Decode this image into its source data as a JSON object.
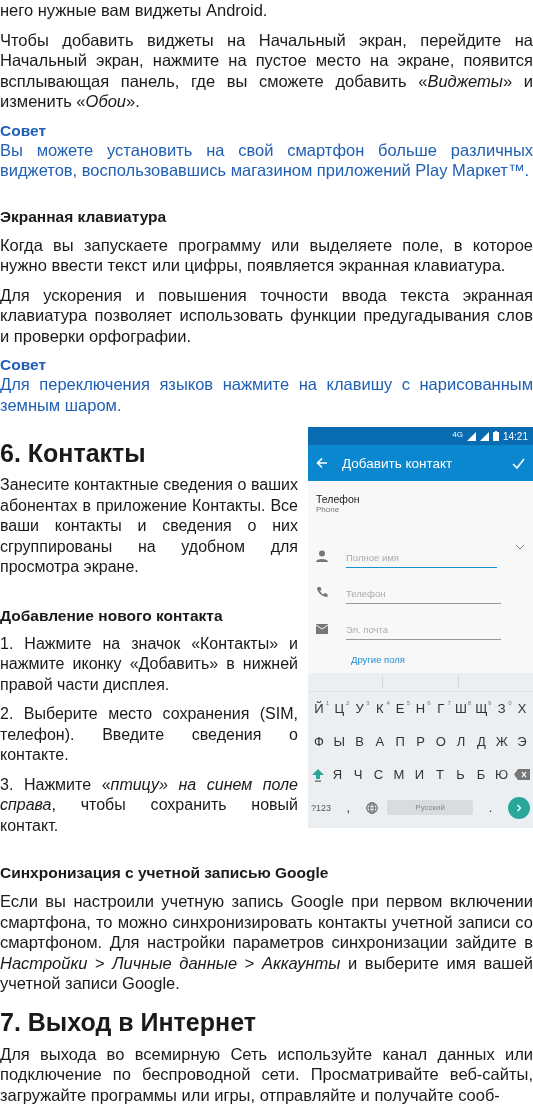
{
  "intro_paragraphs": [
    "него нужные вам виджеты Android.",
    "Чтобы добавить виджеты на Начальный экран, перейдите на Начальный экран, нажмите на пустое место на экране, появится всплывающая панель, где вы сможете добавить «*Виджеты*» и изменить «*Обои*»."
  ],
  "tip_1": {
    "title": "Совет",
    "text": "Вы можете установить на свой смартфон больше различных виджетов, воспользовавшись магазином приложений Play Маркет™."
  },
  "keyboard_section": {
    "heading": "Экранная клавиатура",
    "paragraphs": [
      "Когда вы запускаете программу или выделяете поле, в которое нужно ввести текст или цифры, появляется экранная клавиатура.",
      "Для ускорения и повышения точности ввода текста экранная клавиатура позволяет использовать функции предугадывания слов и проверки орфографии."
    ]
  },
  "tip_2": {
    "title": "Совет",
    "text": "Для переключения языков нажмите на клавишу  с нарисованным земным шаром."
  },
  "contacts_section": {
    "heading": "6. Контакты",
    "intro": "Занесите контактные сведения о ваших абонентах в приложение Контакты. Все ваши контакты и сведения о них сгруппированы на удобном для просмотра экране.",
    "subheading": "Добавление нового контакта",
    "steps": [
      "1. Нажмите на значок «Контакты» и нажмите иконку «Добавить» в нижней правой части дисплея.",
      "2. Выберите место сохранения (SIM, телефон). Введите сведения о контакте.",
      "3. Нажмите «*птицу» на синем поле справа*, чтобы сохранить новый контакт."
    ]
  },
  "phone_screenshot": {
    "network": "4G",
    "time": "14:21",
    "title": "Добавить контакт",
    "account_title": "Телефон",
    "account_subtitle": "Phone",
    "fields": [
      {
        "kind": "name",
        "placeholder": "Полное имя",
        "focused": true
      },
      {
        "kind": "phone",
        "placeholder": "Телефон",
        "focused": false
      },
      {
        "kind": "email",
        "placeholder": "Эл. почта",
        "focused": false
      }
    ],
    "more_fields": "Другие поля",
    "keyboard": {
      "rows": [
        [
          {
            "label": "Й",
            "hint": "1"
          },
          {
            "label": "Ц",
            "hint": "2"
          },
          {
            "label": "У",
            "hint": "3"
          },
          {
            "label": "К",
            "hint": "4"
          },
          {
            "label": "Е",
            "hint": "5"
          },
          {
            "label": "Н",
            "hint": "6"
          },
          {
            "label": "Г",
            "hint": "7"
          },
          {
            "label": "Ш",
            "hint": "8"
          },
          {
            "label": "Щ",
            "hint": "9"
          },
          {
            "label": "З",
            "hint": "0"
          },
          {
            "label": "Х"
          }
        ],
        [
          {
            "label": "Ф"
          },
          {
            "label": "Ы"
          },
          {
            "label": "В"
          },
          {
            "label": "А"
          },
          {
            "label": "П"
          },
          {
            "label": "Р"
          },
          {
            "label": "О"
          },
          {
            "label": "Л"
          },
          {
            "label": "Д"
          },
          {
            "label": "Ж"
          },
          {
            "label": "Э"
          }
        ],
        [
          {
            "kind": "shift"
          },
          {
            "label": "Я"
          },
          {
            "label": "Ч"
          },
          {
            "label": "С"
          },
          {
            "label": "М"
          },
          {
            "label": "И"
          },
          {
            "label": "Т"
          },
          {
            "label": "Ь"
          },
          {
            "label": "Б"
          },
          {
            "label": "Ю"
          },
          {
            "kind": "backspace"
          }
        ]
      ],
      "symbols_key": "?123",
      "comma_key": ",",
      "space_key": "Русский",
      "period_key": "."
    }
  },
  "sync_section": {
    "heading": "Синхронизация с учетной записью Google",
    "paragraph": "Если вы настроили учетную запись Google при первом включении смартфона, то можно синхронизировать контакты учетной записи со смартфоном. Для настройки параметров синхронизации зайдите в *Настройки* > *Личные данные* > *Аккаунты* и выберите имя вашей учетной записи Google."
  },
  "internet_section": {
    "heading": "7. Выход в Интернет",
    "paragraph": "Для выхода во всемирную Сеть используйте канал данных или подключение по беспроводной сети. Просматривайте веб-сайты, загружайте программы или игры, отправляйте и получайте сооб-"
  }
}
